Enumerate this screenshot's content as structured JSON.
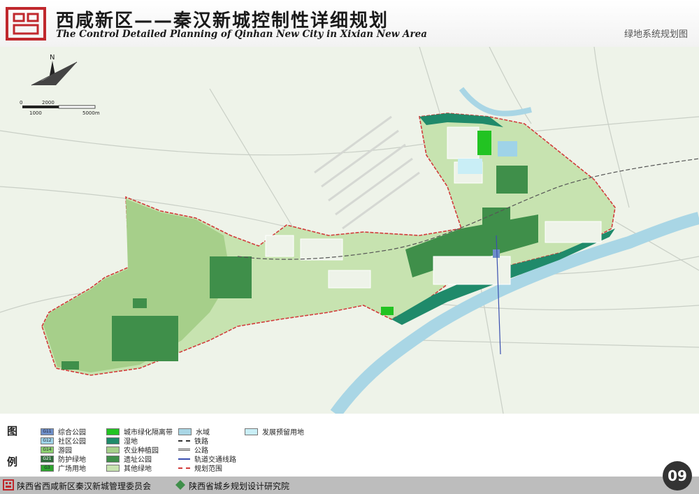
{
  "header": {
    "title_cn": "西咸新区——秦汉新城控制性详细规划",
    "title_en": "The Control Detailed Planning of Qinhan New City in Xixian New Area",
    "sheet_title": "绿地系统规划图"
  },
  "map": {
    "north_label": "N",
    "scale_labels": [
      "0",
      "2000",
      "1000",
      "5000m"
    ],
    "colors": {
      "base": "#eef3e9",
      "agri": "#a6cf8a",
      "other_green": "#c7e3b0",
      "wetland": "#1f8a6a",
      "relic_park": "#3f8f4a",
      "belt": "#22c322",
      "water": "#a9d6e5",
      "boundary": "#d23c3c"
    }
  },
  "legend": {
    "side_top": "图",
    "side_bottom": "例",
    "items": [
      {
        "code": "G11",
        "label": "综合公园",
        "color": "#6e8fc8"
      },
      {
        "code": "G12",
        "label": "社区公园",
        "color": "#9fd3e8"
      },
      {
        "code": "G14",
        "label": "游园",
        "color": "#8ccf6e"
      },
      {
        "code": "G21",
        "label": "防护绿地",
        "color": "#2f6e3b"
      },
      {
        "code": "G3",
        "label": "广场用地",
        "color": "#2ea52e"
      },
      {
        "code": "",
        "label": "城市绿化隔离带",
        "color": "#22c322"
      },
      {
        "code": "",
        "label": "湿地",
        "color": "#1f8a6a"
      },
      {
        "code": "",
        "label": "农业种植园",
        "color": "#a6cf8a"
      },
      {
        "code": "",
        "label": "遗址公园",
        "color": "#3f8f4a"
      },
      {
        "code": "",
        "label": "其他绿地",
        "color": "#c7e3b0"
      },
      {
        "code": "",
        "label": "水域",
        "color": "#a9d6e5"
      },
      {
        "code": "",
        "label": "铁路",
        "color": "#333333"
      },
      {
        "code": "",
        "label": "公路",
        "color": "#555555"
      },
      {
        "code": "",
        "label": "轨道交通线路",
        "color": "#3a4fb0"
      },
      {
        "code": "",
        "label": "规划范围",
        "color": "#d23c3c"
      },
      {
        "code": "",
        "label": "发展预留用地",
        "color": "#c9eef6"
      }
    ]
  },
  "footer": {
    "left": "陕西省西咸新区秦汉新城管理委员会",
    "mid": "陕西省城乡规划设计研究院",
    "page": "09"
  }
}
